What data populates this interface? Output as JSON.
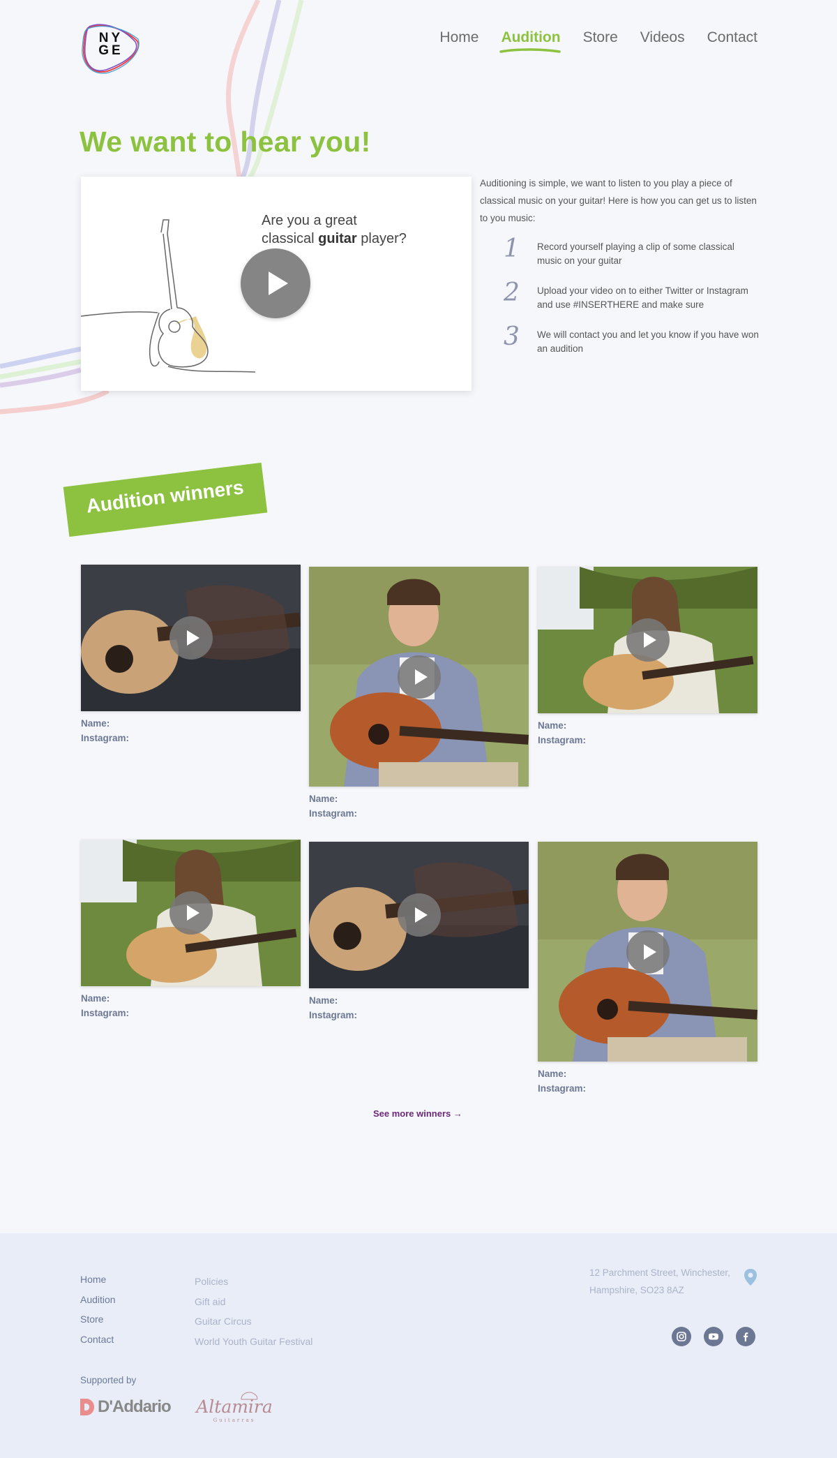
{
  "brand": {
    "logo_text_line1": "NY",
    "logo_text_line2": "GE"
  },
  "nav": {
    "items": [
      {
        "label": "Home",
        "active": false
      },
      {
        "label": "Audition",
        "active": true
      },
      {
        "label": "Store",
        "active": false
      },
      {
        "label": "Videos",
        "active": false
      },
      {
        "label": "Contact",
        "active": false
      }
    ]
  },
  "hero": {
    "title": "We want to hear you!",
    "card_question_line1": "Are you a great",
    "card_question_pre": "classical ",
    "card_question_bold": "guitar",
    "card_question_post": " player?",
    "intro": "Auditioning is simple, we want to listen to you play a piece of classical music on your guitar! Here is how you can get us to listen to you music:",
    "steps": [
      {
        "num": "1",
        "text": "Record yourself playing a clip of some classical music on your guitar"
      },
      {
        "num": "2",
        "text": "Upload your video on to either Twitter or Instagram and use #INSERTHERE and make sure"
      },
      {
        "num": "3",
        "text": "We will contact you and let you know if you have won an audition"
      }
    ]
  },
  "winners": {
    "title": "Audition winners",
    "name_label": "Name:",
    "instagram_label": "Instagram:",
    "see_more": "See more winners →"
  },
  "footer": {
    "links_main": [
      "Home",
      "Audition",
      "Store",
      "Contact"
    ],
    "links_secondary": [
      "Policies",
      "Gift aid",
      "Guitar Circus",
      "World Youth Guitar Festival"
    ],
    "address": "12 Parchment Street, Winchester, Hampshire, SO23 8AZ",
    "supported_by": "Supported by",
    "sponsor1": "D'Addario",
    "sponsor2": "Altamira",
    "sponsor2_sub": "Guitarras"
  },
  "colors": {
    "accent": "#8cc23f",
    "link_purple": "#6b2a79",
    "footer_bg": "#e9edf7"
  }
}
